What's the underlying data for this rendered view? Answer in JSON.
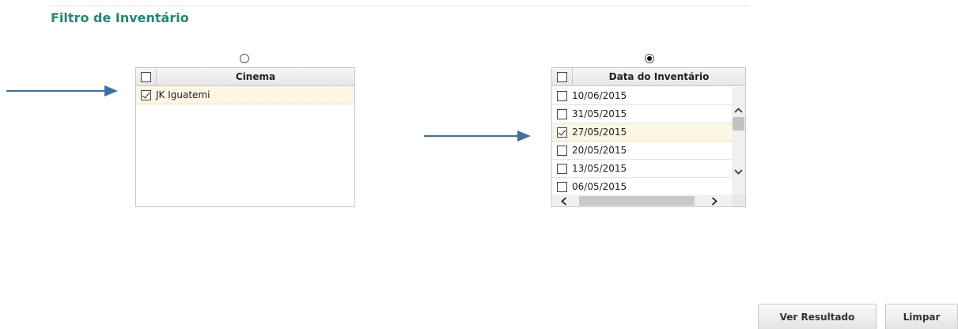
{
  "filter": {
    "title": "Filtro de Inventário"
  },
  "cinema_grid": {
    "mode_selected": false,
    "header_all_checked": false,
    "column_title": "Cinema",
    "rows": [
      {
        "label": "JK Iguatemi",
        "checked": true,
        "selected": true
      }
    ]
  },
  "date_grid": {
    "mode_selected": true,
    "header_all_checked": false,
    "column_title": "Data do Inventário",
    "rows": [
      {
        "label": "10/06/2015",
        "checked": false,
        "selected": false
      },
      {
        "label": "31/05/2015",
        "checked": false,
        "selected": false
      },
      {
        "label": "27/05/2015",
        "checked": true,
        "selected": true
      },
      {
        "label": "20/05/2015",
        "checked": false,
        "selected": false
      },
      {
        "label": "13/05/2015",
        "checked": false,
        "selected": false
      },
      {
        "label": "06/05/2015",
        "checked": false,
        "selected": false
      }
    ]
  },
  "buttons": {
    "ver_resultado": "Ver Resultado",
    "limpar": "Limpar"
  },
  "colors": {
    "title": "#1f8a6e",
    "arrow": "#3f6fa8",
    "selected_row": "#fdf6e3"
  },
  "icons": {
    "annotation": "arrow-right-icon",
    "scroll_up": "chevron-up-icon",
    "scroll_down": "chevron-down-icon",
    "scroll_left": "chevron-left-icon",
    "scroll_right": "chevron-right-icon"
  }
}
